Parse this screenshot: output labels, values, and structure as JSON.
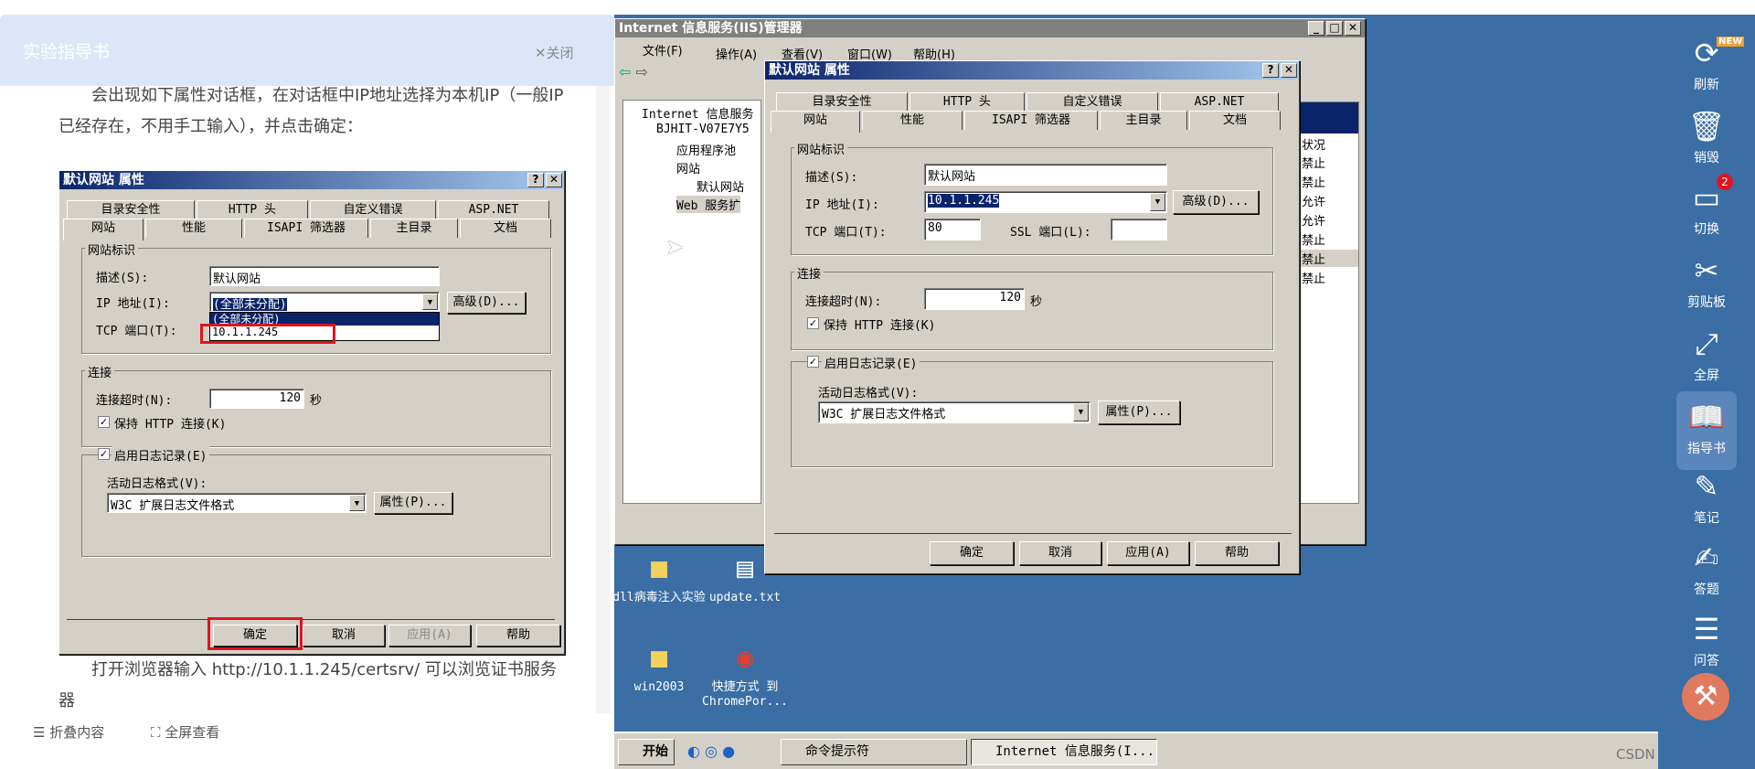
{
  "guide": {
    "title": "实验指导书",
    "close": "✕关闭",
    "para1": "会出现如下属性对话框，在对话框中IP地址选择为本机IP（一般IP已经存在，不用手工输入），并点击确定：",
    "para2": "打开浏览器输入 http://10.1.1.245/certsrv/ 可以浏览证书服务器",
    "fold": "☰ 折叠内容",
    "fullscreen": "⛶ 全屏查看"
  },
  "dialog_left": {
    "title": "默认网站 属性",
    "tabs_row1": [
      "目录安全性",
      "HTTP 头",
      "自定义错误",
      "ASP.NET"
    ],
    "tabs_row2": [
      "网站",
      "性能",
      "ISAPI 筛选器",
      "主目录",
      "文档"
    ],
    "group_site": "网站标识",
    "desc_label": "描述(S):",
    "desc_value": "默认网站",
    "ip_label": "IP 地址(I):",
    "ip_value": "(全部未分配)",
    "ip_options": [
      "(全部未分配)",
      "10.1.1.245"
    ],
    "advanced": "高级(D)...",
    "tcp_label": "TCP 端口(T):",
    "group_conn": "连接",
    "timeout_label": "连接超时(N):",
    "timeout_value": "120",
    "seconds": "秒",
    "keepalive": "保持 HTTP 连接(K)",
    "logging": "启用日志记录(E)",
    "logfmt_label": "活动日志格式(V):",
    "logfmt_value": "W3C 扩展日志文件格式",
    "props": "属性(P)...",
    "ok": "确定",
    "cancel": "取消",
    "apply": "应用(A)",
    "help": "帮助"
  },
  "iis": {
    "title": "Internet 信息服务(IIS)管理器",
    "menu": [
      "文件(F)",
      "操作(A)",
      "查看(V)",
      "窗口(W)",
      "帮助(H)"
    ],
    "tree": [
      "Internet 信息服务",
      "BJHIT-V07E7Y5",
      "应用程序池",
      "网站",
      "默认网站",
      "Web 服务扩"
    ],
    "status_header": "状况",
    "status": [
      "禁止",
      "禁止",
      "允许",
      "允许",
      "禁止",
      "禁止",
      "禁止"
    ]
  },
  "dialog_right": {
    "title": "默认网站 属性",
    "tabs_row1": [
      "目录安全性",
      "HTTP 头",
      "自定义错误",
      "ASP.NET"
    ],
    "tabs_row2": [
      "网站",
      "性能",
      "ISAPI 筛选器",
      "主目录",
      "文档"
    ],
    "group_site": "网站标识",
    "desc_label": "描述(S):",
    "desc_value": "默认网站",
    "ip_label": "IP 地址(I):",
    "ip_value": "10.1.1.245",
    "advanced": "高级(D)...",
    "tcp_label": "TCP 端口(T):",
    "tcp_value": "80",
    "ssl_label": "SSL 端口(L):",
    "ssl_value": "",
    "group_conn": "连接",
    "timeout_label": "连接超时(N):",
    "timeout_value": "120",
    "seconds": "秒",
    "keepalive": "保持 HTTP 连接(K)",
    "logging": "启用日志记录(E)",
    "logfmt_label": "活动日志格式(V):",
    "logfmt_value": "W3C 扩展日志文件格式",
    "props": "属性(P)...",
    "ok": "确定",
    "cancel": "取消",
    "apply": "应用(A)",
    "help": "帮助"
  },
  "desktop": {
    "icons": [
      "dll病毒注入实验",
      "update.txt",
      "win2003",
      "快捷方式 到 ChromePor..."
    ]
  },
  "taskbar": {
    "start": "开始",
    "tasks": [
      "命令提示符",
      "Internet 信息服务(I..."
    ],
    "watermark": "CSDN @麻辣熊"
  },
  "sidebar": {
    "items": [
      "刷新",
      "销毁",
      "切换",
      "剪贴板",
      "全屏",
      "指导书",
      "笔记",
      "答题",
      "问答"
    ],
    "badge": "2",
    "new_tag": "NEW"
  }
}
